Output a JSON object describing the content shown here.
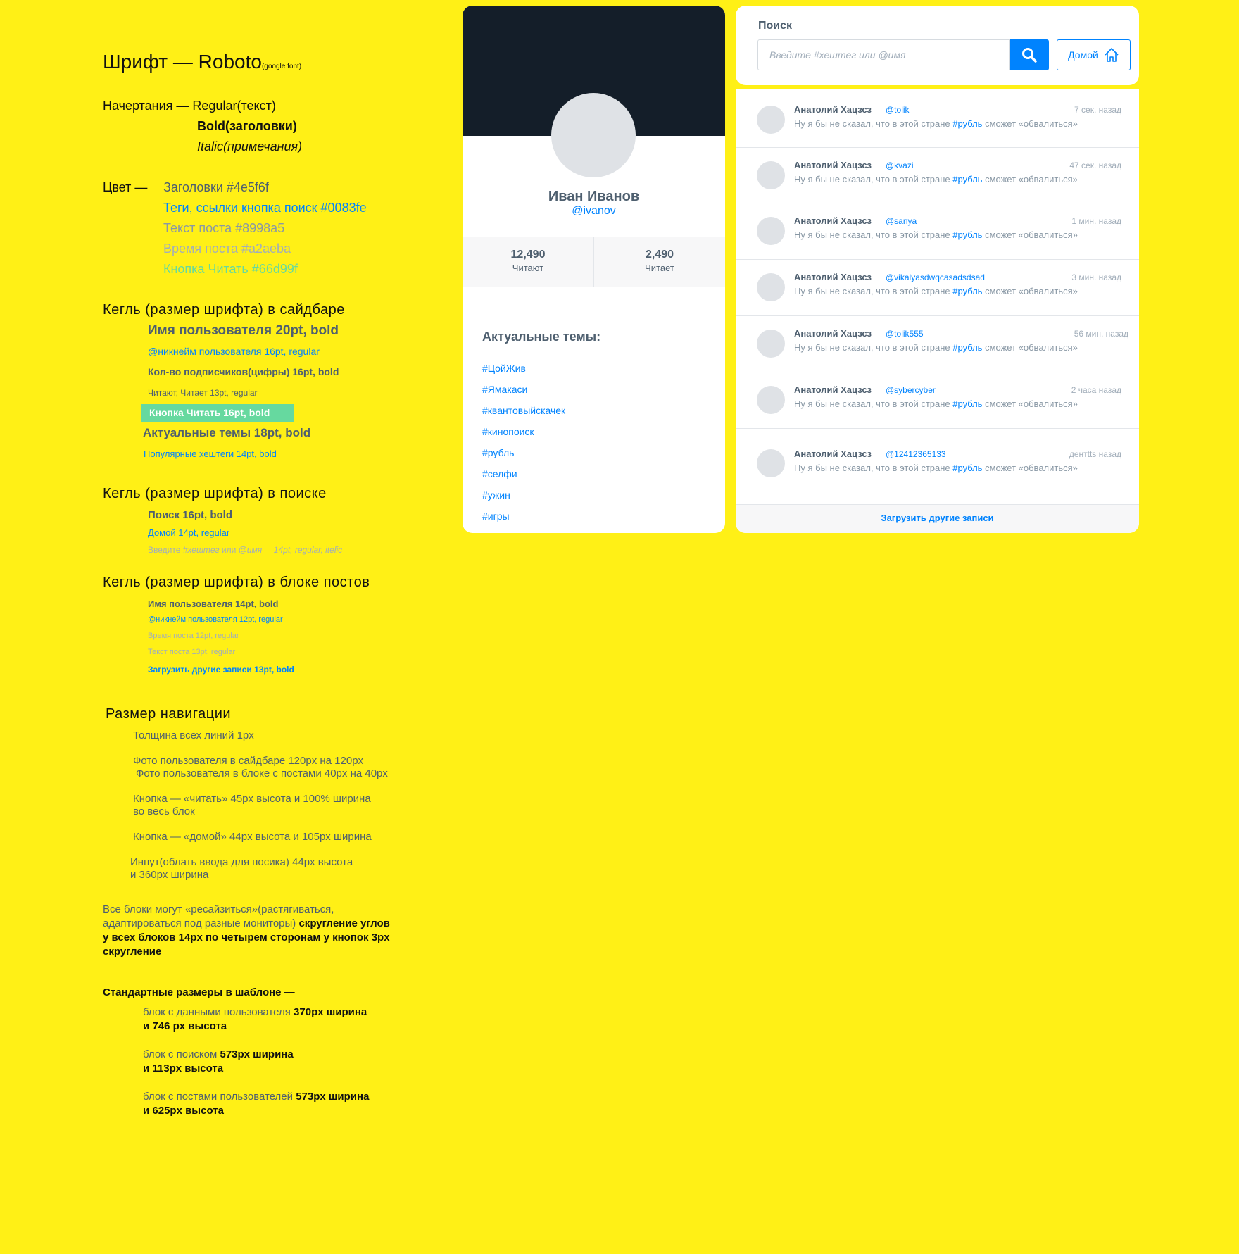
{
  "spec": {
    "font_title": "Шрифт — Roboto",
    "font_note": "(google font)",
    "styles_label": "Начертания — Regular(текст)",
    "styles_bold": "Bold(заголовки)",
    "styles_italic": "Italic(примечания)",
    "color_label": "Цвет —",
    "color_headers": "Заголовки #4e5f6f",
    "color_tags": "Теги, ссылки кнопка поиск #0083fe",
    "color_post_text": "Текст поста #8998a5",
    "color_post_time": "Время поста #a2aeba",
    "color_read_button": "Кнопка Читать #66d99f",
    "sidebar_size_title": "Кегль (размер шрифта) в сайдбаре",
    "sidebar_username": "Имя пользователя 20pt, bold",
    "sidebar_nick": "@никнейм пользователя 16pt, regular",
    "sidebar_followers": "Кол-во подписчиков(цифры) 16pt, bold",
    "sidebar_read_labels": "Читают, Читает 13pt, regular",
    "sidebar_read_button": "Кнопка Читать 16pt, bold",
    "sidebar_topics": "Актуальные темы 18pt, bold",
    "sidebar_hashtags": "Популярные хештеги 14pt, bold",
    "search_size_title": "Кегль (размер шрифта) в поиске",
    "search_label": "Поиск 16pt, bold",
    "search_home": "Домой 14pt, regular",
    "search_placeholder_prefix": "Введите",
    "search_placeholder_italic": "#хештег",
    "search_placeholder_mid": "или",
    "search_placeholder_italic2": "@имя",
    "search_placeholder_spec": "14pt, regular, itelic",
    "posts_size_title": "Кегль (размер шрифта) в блоке постов",
    "posts_username": "Имя пользователя 14pt, bold",
    "posts_nick": "@никнейм пользователя 12pt, regular",
    "posts_time": "Время поста 12pt, regular",
    "posts_text": "Текст поста 13pt, regular",
    "posts_load": "Загрузить другие записи 13pt, bold",
    "nav_title": "Размер навигации",
    "nav_lines": "Толщина всех линий 1px",
    "nav_photo_sidebar": "Фото пользователя в сайдбаре 120px на 120px",
    "nav_photo_posts": "Фото пользователя в блоке с постами 40px на 40px",
    "nav_read_btn_1": "Кнопка — «читать» 45px высота и 100% ширина",
    "nav_read_btn_2": "во весь блок",
    "nav_home_btn": "Кнопка — «домой» 44px высота и 105px ширина",
    "nav_input_1": "Инпут(облать ввода для посика) 44px высота",
    "nav_input_2": "и   360px ширина",
    "resize_1a": "Все блоки могут «ресайзиться»(растягиваться,",
    "resize_2a": "адаптироваться под разные мониторы)",
    "resize_2b": "скругление углов",
    "resize_3": "у всех блоков 14px по четырем сторонам у кнопок 3px",
    "resize_4": "скругление",
    "std_title": "Стандартные размеры в шаблоне —",
    "std_user_1a": "блок с данными пользователя",
    "std_user_1b": "370px ширина",
    "std_user_2": "и 746 px высота",
    "std_search_1a": "блок с поиском",
    "std_search_1b": "573px ширина",
    "std_search_2": "и 113px высота",
    "std_posts_1a": "блок с постами пользователей",
    "std_posts_1b": "573px ширина",
    "std_posts_2": "и 625px высота"
  },
  "profile": {
    "name": "Иван Иванов",
    "nick": "@ivanov",
    "stats": [
      {
        "num": "12,490",
        "label": "Читают"
      },
      {
        "num": "2,490",
        "label": "Читает"
      }
    ],
    "topics_title": "Актуальные темы:",
    "tags": [
      "#ЦойЖив",
      "#Ямакаси",
      "#квантовыйскачек",
      "#кинопоиск",
      "#рубль",
      "#селфи",
      "#ужин",
      "#игры"
    ]
  },
  "search": {
    "title": "Поиск",
    "placeholder": "Введите #хештег или @имя",
    "home_label": "Домой"
  },
  "posts": {
    "items": [
      {
        "name": "Анатолий Хацзсз",
        "nick": "@tolik",
        "time": "7 сек. назад",
        "text_before": "Ну я бы не сказал, что в этой стране ",
        "hashtag": "#рубль",
        "text_after": " сможет «обвалиться»"
      },
      {
        "name": "Анатолий Хацзсз",
        "nick": "@kvazi",
        "time": "47 сек. назад",
        "text_before": "Ну я бы не сказал, что в этой стране ",
        "hashtag": "#рубль",
        "text_after": " сможет «обвалиться»"
      },
      {
        "name": "Анатолий Хацзсз",
        "nick": "@sanya",
        "time": "1 мин. назад",
        "text_before": "Ну я бы не сказал, что в этой стране ",
        "hashtag": "#рубль",
        "text_after": " сможет «обвалиться»"
      },
      {
        "name": "Анатолий Хацзсз",
        "nick": "@vikalyasdwqcasadsdsad",
        "time": "3 мин. назад",
        "text_before": "Ну я бы не сказал, что в этой стране ",
        "hashtag": "#рубль",
        "text_after": " сможет «обвалиться»"
      },
      {
        "name": "Анатолий Хацзсз",
        "nick": "@tolik555",
        "time": "56 мин. назад",
        "text_before": "Ну я бы не сказал, что в этой стране ",
        "hashtag": "#рубль",
        "text_after": " сможет «обвалиться»"
      },
      {
        "name": "Анатолий Хацзсз",
        "nick": "@sybercyber",
        "time": "2 часа назад",
        "text_before": "Ну я бы не сказал, что в этой стране ",
        "hashtag": "#рубль",
        "text_after": " сможет «обвалиться»"
      },
      {
        "name": "Анатолий Хацзсз",
        "nick": "@12412365133",
        "time": "дентtts назад",
        "text_before": "Ну я бы не сказал, что в этой стране ",
        "hashtag": "#рубль",
        "text_after": " сможет «обвалиться»"
      }
    ],
    "load_more": "Загрузить другие записи"
  },
  "colors": {
    "background": "#fff016",
    "headers": "#4e5f6f",
    "links": "#0083fe",
    "post_text": "#8998a5",
    "post_time": "#a2aeba",
    "read_button": "#66d99f"
  }
}
